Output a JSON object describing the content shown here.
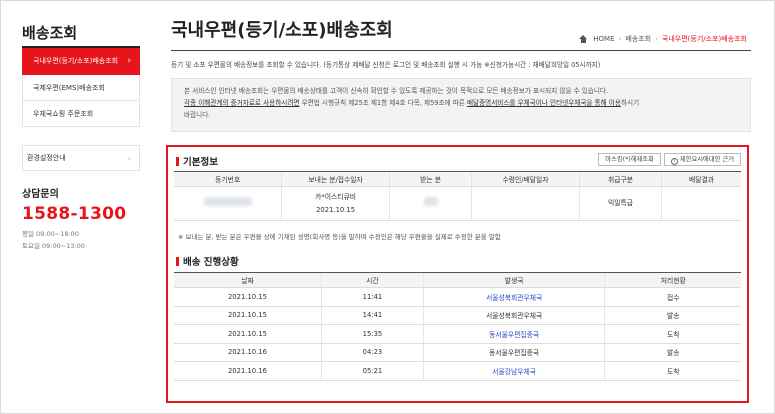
{
  "sidebar": {
    "title": "배송조회",
    "items": [
      {
        "label": "국내우편(등기/소포)배송조회",
        "active": true
      },
      {
        "label": "국제우편(EMS)배송조회",
        "active": false
      },
      {
        "label": "우체국쇼핑 주문조회",
        "active": false
      }
    ],
    "env_label": "환경설정안내",
    "consult_title": "상담문의",
    "consult_phone": "1588-1300",
    "hours_weekday": "평일 09:00~18:00",
    "hours_sat": "토요일 09:00~13:00"
  },
  "header": {
    "title": "국내우편(등기/소포)배송조회",
    "breadcrumb": {
      "home": "HOME",
      "b1": "배송조회",
      "b2": "국내우편(등기/소포)배송조회"
    }
  },
  "intro": "등기 및 소포 우편물의 배송정보를 조회할 수 있습니다. (등기통상 제배달 신청은 로그인 및 배송조회 실행 시 가능 ※신청가능시간 : 재배달희망일 05시까지)",
  "notice": {
    "line1": "본 서비스인 인터넷 배송조회는 우편물의 배송상태를 고객이 신속히 확인할 수 있도록 제공하는 것이 목적으로 모든 배송정보가 표시되지 않을 수 있습니다.",
    "link1": "각종 이해관계의 증거자료로 사용하시려면",
    "line2a": " 우편법 시행규칙 제25조 제1항 제4호 다목, 제59조에 따른 ",
    "link2": "배달증명서비스를 우체국이나 인터넷우체국을 통해 이용",
    "line2b": "하시기",
    "line3": "바랍니다."
  },
  "basic": {
    "heading": "기본정보",
    "btn_kor": "마스킹(*)해제조회",
    "btn_info": "제한요시에대한 근거",
    "headers": [
      "등기번호",
      "보내는 분/접수일자",
      "받는 분",
      "수령인/배달일자",
      "취급구분",
      "배달결과"
    ],
    "row": {
      "sender": "카*이스티큐비",
      "date": "2021.10.15",
      "type": "익일특급"
    },
    "note": "※ 보내는 분, 받는 분은 우편물 상에 기재된 성명(회사명 등)을 말하며 수정인은 해당 우편물을 실제로 수정한 분을 말함"
  },
  "progress": {
    "heading": "배송 진행상황",
    "headers": [
      "날짜",
      "시간",
      "발생국",
      "처리현황"
    ],
    "rows": [
      {
        "date": "2021.10.15",
        "time": "11:41",
        "office": "서울성북회관우체국",
        "status": "접수",
        "link": true
      },
      {
        "date": "2021.10.15",
        "time": "14:41",
        "office": "서울성북회관우체국",
        "status": "발송",
        "link": false
      },
      {
        "date": "2021.10.15",
        "time": "15:35",
        "office": "동서울우편집중국",
        "status": "도착",
        "link": true
      },
      {
        "date": "2021.10.16",
        "time": "04:23",
        "office": "동서울우편집중국",
        "status": "발송",
        "link": false
      },
      {
        "date": "2021.10.16",
        "time": "05:21",
        "office": "서울강남우체국",
        "status": "도착",
        "link": true
      }
    ]
  },
  "colors": {
    "accent": "#e8141b",
    "link": "#2347c9"
  }
}
